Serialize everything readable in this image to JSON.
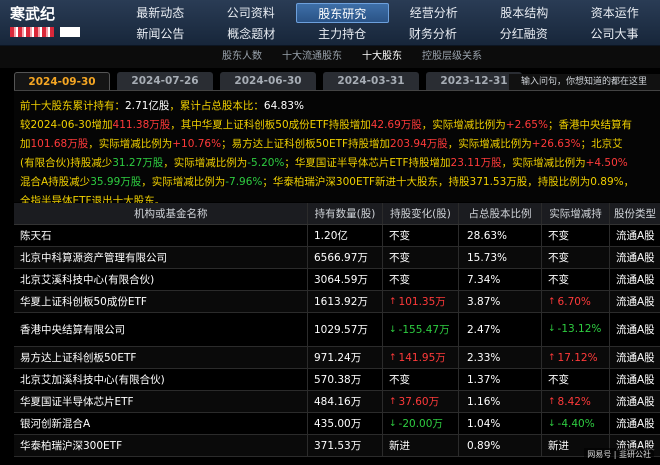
{
  "brand": {
    "name": "寒武纪"
  },
  "nav": {
    "row1": [
      "最新动态",
      "公司资料",
      "股东研究",
      "经营分析",
      "股本结构",
      "资本运作"
    ],
    "row2": [
      "新闻公告",
      "概念题材",
      "主力持仓",
      "财务分析",
      "分红融资",
      "公司大事"
    ],
    "active": "股东研究"
  },
  "subnav": {
    "items": [
      "股东人数",
      "十大流通股东",
      "十大股东",
      "控股层级关系"
    ],
    "active": "十大股东"
  },
  "date_tabs": {
    "items": [
      "2024-09-30",
      "2024-07-26",
      "2024-06-30",
      "2024-03-31",
      "2023-12-31"
    ],
    "active": "2024-09-30"
  },
  "search": {
    "placeholder": "输入问句，你想知道的都在这里"
  },
  "summary": {
    "l1_a": "前十大股东累计持有：",
    "l1_b": "2.71亿股",
    "l1_c": "，累计占总股本比：",
    "l1_d": "64.83%",
    "l2_a": "较2024-06-30增加",
    "l2_b": "411.38万股",
    "l2_c": "，其中华夏上证科创板50成份ETF持股增加",
    "l2_d": "42.69万股",
    "l2_e": "，实际增减比例为",
    "l2_f": "+2.65%",
    "l2_g": "；香港中央结算有",
    "l3_a": "加",
    "l3_b": "101.68万股",
    "l3_c": "，实际增减比例为",
    "l3_d": "+10.76%",
    "l3_e": "；易方达上证科创板50ETF持股增加",
    "l3_f": "203.94万股",
    "l3_g": "，实际增减比例为",
    "l3_h": "+26.63%",
    "l3_i": "；北京艾",
    "l4_a": "(有限合伙)持股减少",
    "l4_b": "31.27万股",
    "l4_c": "，实际增减比例为",
    "l4_d": "-5.20%",
    "l4_e": "；华夏国证半导体芯片ETF持股增加",
    "l4_f": "23.11万股",
    "l4_g": "，实际增减比例为",
    "l4_h": "+4.50%",
    "l5_a": "混合A持股减少",
    "l5_b": "35.99万股",
    "l5_c": "，实际增减比例为",
    "l5_d": "-7.96%",
    "l5_e": "；华泰柏瑞沪深300ETF新进十大股东，持股371.53万股，持股比例为0.89%，",
    "l6_a": "全指半导体ETF退出十大股东。"
  },
  "table": {
    "headers": [
      "机构或基金名称",
      "持有数量(股)",
      "持股变化(股)",
      "占总股本比例",
      "实际增减持",
      "股份类型"
    ],
    "rows": [
      {
        "name": "陈天石",
        "qty": "1.20亿",
        "change": "不变",
        "dir": "st",
        "pct": "28.63%",
        "act": "不变",
        "act_dir": "st",
        "type": "流通A股"
      },
      {
        "name": "北京中科算源资产管理有限公司",
        "qty": "6566.97万",
        "change": "不变",
        "dir": "st",
        "pct": "15.73%",
        "act": "不变",
        "act_dir": "st",
        "type": "流通A股"
      },
      {
        "name": "北京艾溪科技中心(有限合伙)",
        "qty": "3064.59万",
        "change": "不变",
        "dir": "st",
        "pct": "7.34%",
        "act": "不变",
        "act_dir": "st",
        "type": "流通A股"
      },
      {
        "name": "华夏上证科创板50成份ETF",
        "qty": "1613.92万",
        "change": "101.35万",
        "dir": "up",
        "pct": "3.87%",
        "act": "6.70%",
        "act_dir": "up",
        "type": "流通A股"
      },
      {
        "name": "香港中央结算有限公司",
        "qty": "1029.57万",
        "change": "-155.47万",
        "dir": "dn",
        "pct": "2.47%",
        "act": "-13.12%",
        "act_dir": "dn",
        "type": "流通A股"
      },
      {
        "name": "易方达上证科创板50ETF",
        "qty": "971.24万",
        "change": "141.95万",
        "dir": "up",
        "pct": "2.33%",
        "act": "17.12%",
        "act_dir": "up",
        "type": "流通A股"
      },
      {
        "name": "北京艾加溪科技中心(有限合伙)",
        "qty": "570.38万",
        "change": "不变",
        "dir": "st",
        "pct": "1.37%",
        "act": "不变",
        "act_dir": "st",
        "type": "流通A股"
      },
      {
        "name": "华夏国证半导体芯片ETF",
        "qty": "484.16万",
        "change": "37.60万",
        "dir": "up",
        "pct": "1.16%",
        "act": "8.42%",
        "act_dir": "up",
        "type": "流通A股"
      },
      {
        "name": "银河创新混合A",
        "qty": "435.00万",
        "change": "-20.00万",
        "dir": "dn",
        "pct": "1.04%",
        "act": "-4.40%",
        "act_dir": "dn",
        "type": "流通A股"
      },
      {
        "name": "华泰柏瑞沪深300ETF",
        "qty": "371.53万",
        "change": "新进",
        "dir": "new",
        "pct": "0.89%",
        "act": "新进",
        "act_dir": "new",
        "type": "流通A股"
      }
    ]
  },
  "watermark": "网易号 | 韭研公社",
  "colors": {
    "up": "#ff3a3a",
    "down": "#2ecc40",
    "highlight": "#f0d000",
    "accent_tab": "#f5a623"
  }
}
